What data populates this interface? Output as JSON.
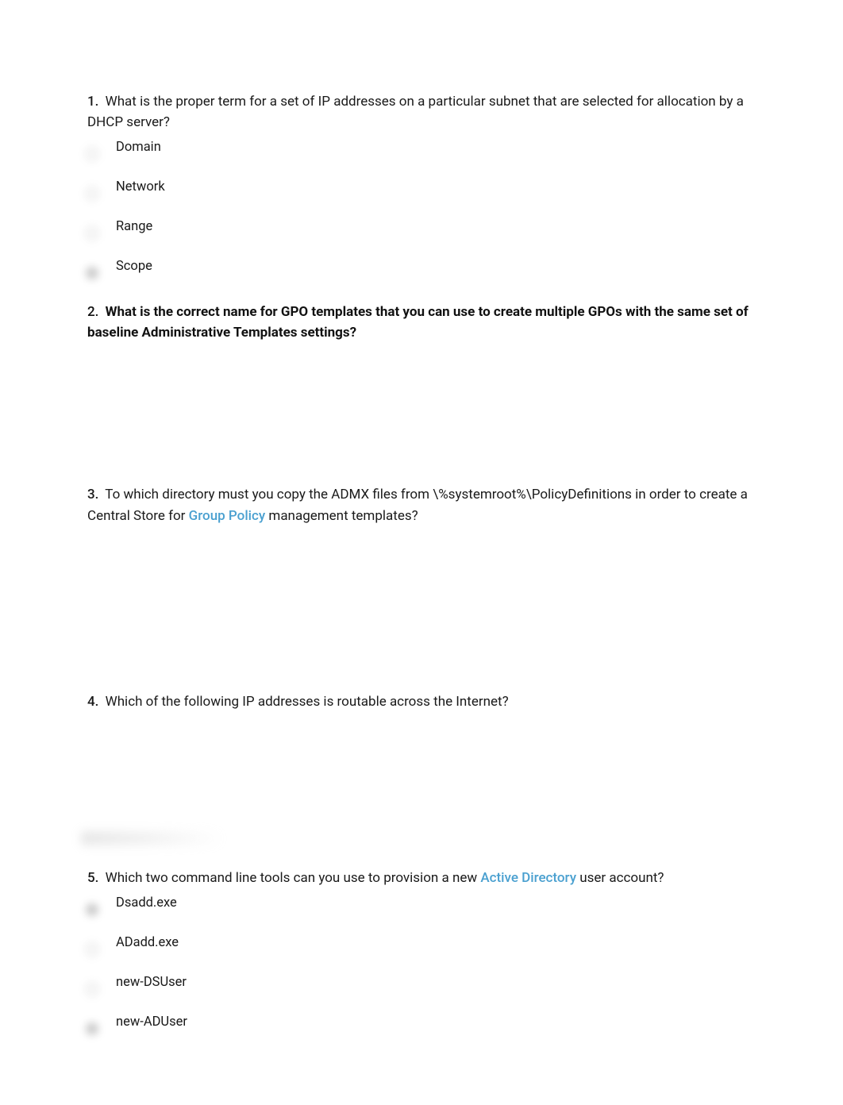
{
  "questions": {
    "q1": {
      "num": "1.",
      "text": "What is the proper term for a set of IP addresses on a particular subnet that are selected for allocation by a DHCP server?",
      "options": {
        "a": "Domain",
        "b": "Network",
        "c": "Range",
        "d": "Scope"
      }
    },
    "q2": {
      "num": "2.",
      "text": "What is the correct name for GPO templates that you can use to create multiple GPOs with the same set of baseline Administrative Templates settings?"
    },
    "q3": {
      "num": "3.",
      "text_before": "To which directory must you copy the ADMX files from \\%systemroot%\\PolicyDefinitions in order to create a Central Store for",
      "link": "Group Policy",
      "text_after": "management templates?"
    },
    "q4": {
      "num": "4.",
      "text": "Which of the following IP addresses is routable across the Internet?"
    },
    "q5": {
      "num": "5.",
      "text_before": "Which two command line tools can you use to provision a new",
      "link": "Active Directory",
      "text_after": "user account?",
      "options": {
        "a": "Dsadd.exe",
        "b": "ADadd.exe",
        "c": "new-DSUser",
        "d": "new-ADUser"
      }
    }
  }
}
